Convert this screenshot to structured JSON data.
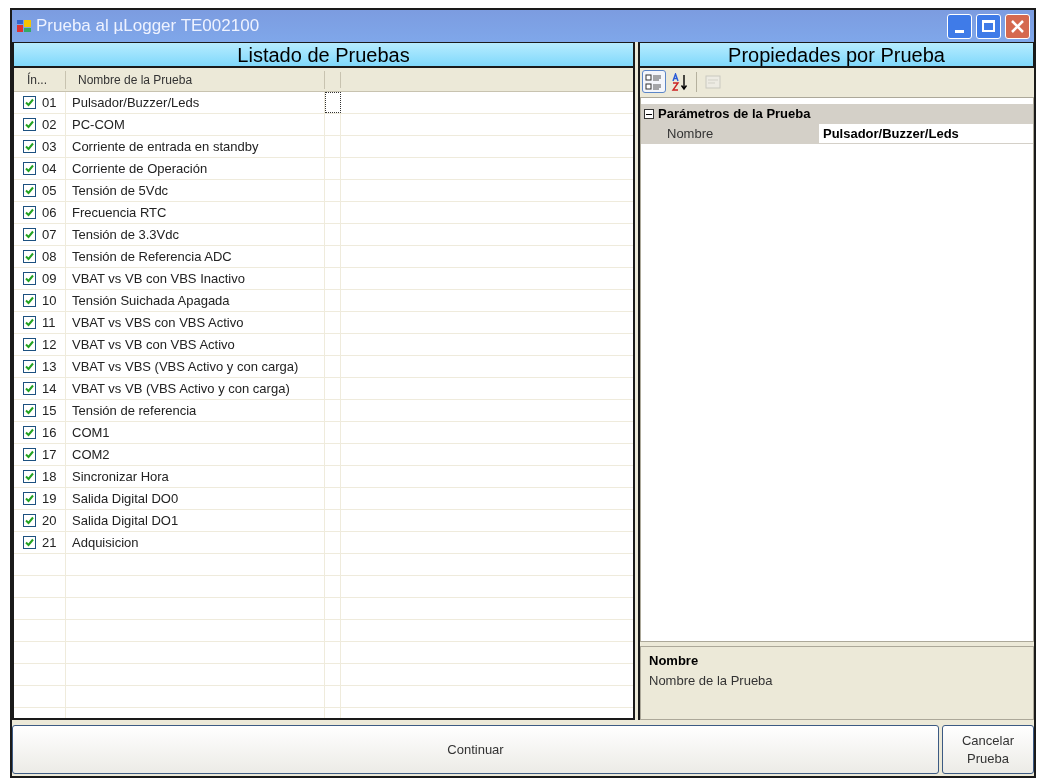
{
  "window": {
    "title": "Prueba al µLogger TE002100"
  },
  "left_panel": {
    "title": "Listado de Pruebas",
    "columns": [
      "Ín...",
      "Nombre de la Prueba"
    ],
    "rows": [
      {
        "index": "01",
        "name": "Pulsador/Buzzer/Leds",
        "checked": true,
        "focused": true
      },
      {
        "index": "02",
        "name": "PC-COM",
        "checked": true,
        "focused": false
      },
      {
        "index": "03",
        "name": "Corriente de entrada en standby",
        "checked": true,
        "focused": false
      },
      {
        "index": "04",
        "name": "Corriente de Operación",
        "checked": true,
        "focused": false
      },
      {
        "index": "05",
        "name": "Tensión de 5Vdc",
        "checked": true,
        "focused": false
      },
      {
        "index": "06",
        "name": "Frecuencia RTC",
        "checked": true,
        "focused": false
      },
      {
        "index": "07",
        "name": "Tensión de 3.3Vdc",
        "checked": true,
        "focused": false
      },
      {
        "index": "08",
        "name": "Tensión de Referencia ADC",
        "checked": true,
        "focused": false
      },
      {
        "index": "09",
        "name": "VBAT vs VB con VBS Inactivo",
        "checked": true,
        "focused": false
      },
      {
        "index": "10",
        "name": "Tensión Suichada Apagada",
        "checked": true,
        "focused": false
      },
      {
        "index": "11",
        "name": "VBAT vs VBS con VBS Activo",
        "checked": true,
        "focused": false
      },
      {
        "index": "12",
        "name": "VBAT vs VB con VBS Activo",
        "checked": true,
        "focused": false
      },
      {
        "index": "13",
        "name": "VBAT vs VBS (VBS Activo y con carga)",
        "checked": true,
        "focused": false
      },
      {
        "index": "14",
        "name": "VBAT vs VB (VBS Activo y con carga)",
        "checked": true,
        "focused": false
      },
      {
        "index": "15",
        "name": "Tensión de referencia",
        "checked": true,
        "focused": false
      },
      {
        "index": "16",
        "name": "COM1",
        "checked": true,
        "focused": false
      },
      {
        "index": "17",
        "name": "COM2",
        "checked": true,
        "focused": false
      },
      {
        "index": "18",
        "name": "Sincronizar Hora",
        "checked": true,
        "focused": false
      },
      {
        "index": "19",
        "name": "Salida Digital DO0",
        "checked": true,
        "focused": false
      },
      {
        "index": "20",
        "name": "Salida Digital DO1",
        "checked": true,
        "focused": false
      },
      {
        "index": "21",
        "name": "Adquisicion",
        "checked": true,
        "focused": false
      }
    ]
  },
  "right_panel": {
    "title": "Propiedades por Prueba",
    "toolbar": [
      {
        "kind": "categorized",
        "selected": true,
        "disabled": false
      },
      {
        "kind": "alphabetical",
        "selected": false,
        "disabled": false
      },
      {
        "kind": "pages",
        "selected": false,
        "disabled": true
      }
    ],
    "category": {
      "label": "Parámetros de la Prueba",
      "expanded": true,
      "properties": [
        {
          "name": "Nombre",
          "value": "Pulsador/Buzzer/Leds"
        }
      ]
    },
    "description": {
      "title": "Nombre",
      "text": "Nombre de la Prueba"
    }
  },
  "buttons": [
    {
      "kind": "continue",
      "label": "Continuar"
    },
    {
      "kind": "cancel",
      "label": "Cancelar Prueba"
    }
  ]
}
